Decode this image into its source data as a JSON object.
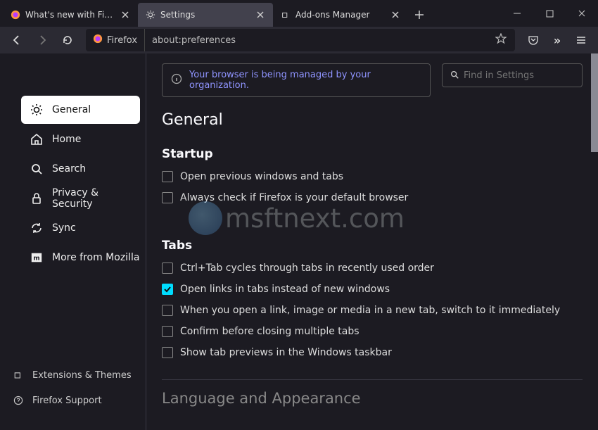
{
  "tabs": [
    {
      "label": "What's new with Firefox - More",
      "icon": "firefox"
    },
    {
      "label": "Settings",
      "icon": "gear"
    },
    {
      "label": "Add-ons Manager",
      "icon": "puzzle"
    }
  ],
  "urlbar": {
    "origin": "Firefox",
    "text": "about:preferences"
  },
  "notice": "Your browser is being managed by your organization.",
  "search_placeholder": "Find in Settings",
  "heading": "General",
  "sidebar": [
    {
      "label": "General"
    },
    {
      "label": "Home"
    },
    {
      "label": "Search"
    },
    {
      "label": "Privacy & Security"
    },
    {
      "label": "Sync"
    },
    {
      "label": "More from Mozilla"
    }
  ],
  "sidebar_footer": [
    {
      "label": "Extensions & Themes"
    },
    {
      "label": "Firefox Support"
    }
  ],
  "startup": {
    "heading": "Startup",
    "opts": [
      "Open previous windows and tabs",
      "Always check if Firefox is your default browser"
    ]
  },
  "tabs_section": {
    "heading": "Tabs",
    "opts": [
      "Ctrl+Tab cycles through tabs in recently used order",
      "Open links in tabs instead of new windows",
      "When you open a link, image or media in a new tab, switch to it immediately",
      "Confirm before closing multiple tabs",
      "Show tab previews in the Windows taskbar"
    ],
    "checked_index": 1
  },
  "lang_heading": "Language and Appearance",
  "watermark": "msftnext.com"
}
